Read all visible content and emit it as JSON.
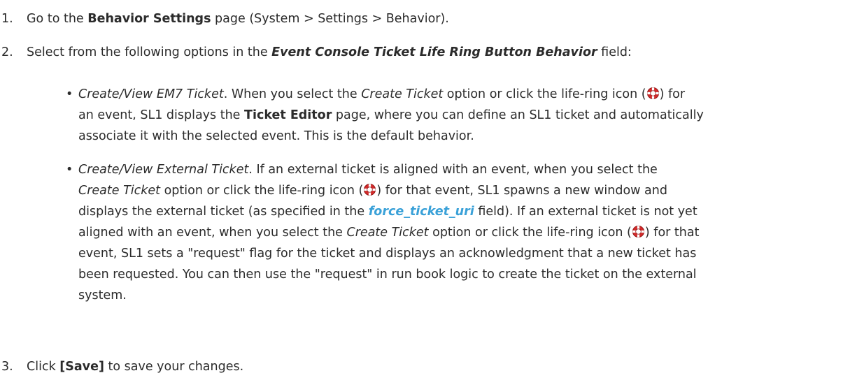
{
  "steps": [
    {
      "number": "1.",
      "parts": [
        "Go to the ",
        "Behavior Settings",
        " page (System > Settings > Behavior)."
      ]
    },
    {
      "number": "2.",
      "parts": [
        "Select from the following options in the ",
        "Event Console Ticket Life Ring Button Behavior",
        " field:"
      ],
      "bullets": [
        {
          "lines": [
            [
              "Create/View EM7 Ticket",
              ". When you select the ",
              "Create Ticket",
              " option or click the life-ring icon (",
              ") for"
            ],
            [
              "an event, SL1 displays the ",
              "Ticket Editor",
              " page, where you can define an SL1 ticket and automatically"
            ],
            [
              "associate it with the selected event. This is the default behavior."
            ]
          ]
        },
        {
          "lines": [
            [
              "Create/View External Ticket",
              ". If an external ticket is aligned with an event, when you select the"
            ],
            [
              "Create Ticket",
              " option or click the life-ring icon (",
              ") for that event, SL1 spawns a new window and"
            ],
            [
              "displays the external ticket (as specified in the ",
              "force_ticket_uri",
              " field). If an external ticket is not yet"
            ],
            [
              "aligned with an event, when you select the ",
              "Create Ticket",
              " option or click the life-ring icon (",
              ") for that"
            ],
            [
              "event, SL1 sets a \"request\" flag for the ticket and displays an acknowledgment that a new ticket has"
            ],
            [
              "been requested. You can then use the \"request\" in run book logic to create the ticket on the external"
            ],
            [
              "system."
            ]
          ]
        }
      ]
    },
    {
      "number": "3.",
      "parts": [
        "Click ",
        "[Save]",
        " to save your changes."
      ]
    }
  ],
  "icons": {
    "life_ring": "life-ring-icon",
    "bullet": "bullet-dot"
  },
  "colors": {
    "link": "#3aa1d8",
    "text": "#2b2b2b",
    "life_ring_red": "#d42a2a"
  }
}
